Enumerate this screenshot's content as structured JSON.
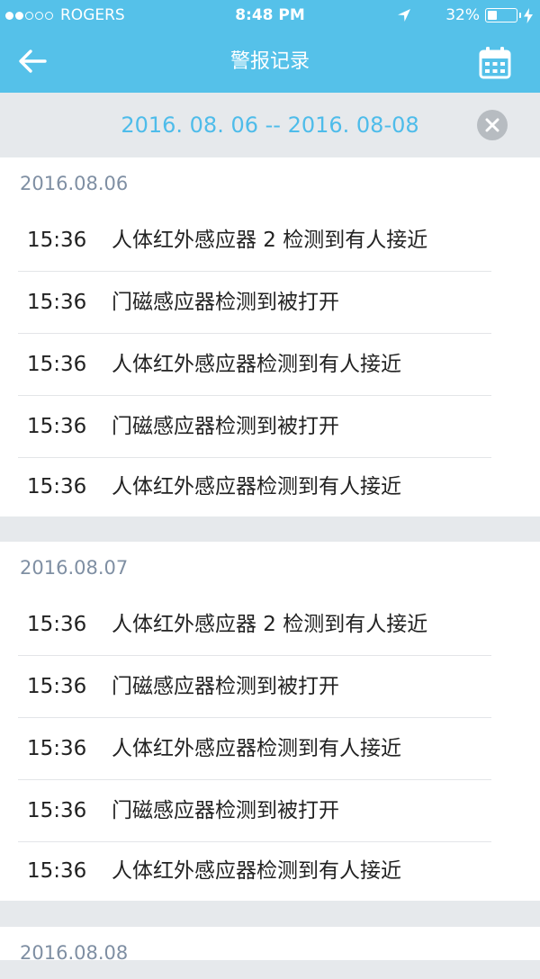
{
  "status_bar": {
    "carrier": "ROGERS",
    "time": "8:48 PM",
    "battery_percent": "32%",
    "battery_level": 0.32,
    "signal_bars_filled": 2,
    "signal_bars_total": 5
  },
  "nav": {
    "title": "警报记录",
    "back_icon": "arrow-left-icon",
    "calendar_icon": "calendar-icon"
  },
  "filter": {
    "date_range": "2016. 08. 06 -- 2016. 08-08",
    "clear_icon": "close-circle-icon"
  },
  "colors": {
    "header": "#55c1e9",
    "accent_text": "#4ebcea",
    "background": "#e6e9ec",
    "section_date": "#7f8fa3"
  },
  "sections": [
    {
      "date": "2016.08.06",
      "records": [
        {
          "time": "15:36",
          "message": "人体红外感应器 2 检测到有人接近"
        },
        {
          "time": "15:36",
          "message": "门磁感应器检测到被打开"
        },
        {
          "time": "15:36",
          "message": "人体红外感应器检测到有人接近"
        },
        {
          "time": "15:36",
          "message": "门磁感应器检测到被打开"
        },
        {
          "time": "15:36",
          "message": "人体红外感应器检测到有人接近"
        }
      ]
    },
    {
      "date": "2016.08.07",
      "records": [
        {
          "time": "15:36",
          "message": "人体红外感应器 2 检测到有人接近"
        },
        {
          "time": "15:36",
          "message": "门磁感应器检测到被打开"
        },
        {
          "time": "15:36",
          "message": "人体红外感应器检测到有人接近"
        },
        {
          "time": "15:36",
          "message": "门磁感应器检测到被打开"
        },
        {
          "time": "15:36",
          "message": "人体红外感应器检测到有人接近"
        }
      ]
    },
    {
      "date": "2016.08.08",
      "records": []
    }
  ]
}
